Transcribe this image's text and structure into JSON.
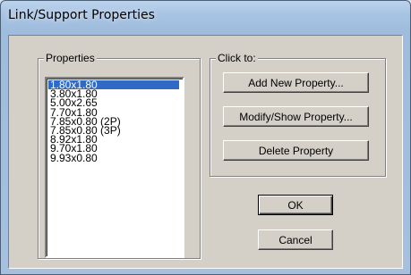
{
  "window": {
    "title": "Link/Support Properties"
  },
  "properties_group": {
    "label": "Properties",
    "items": [
      {
        "label": "1.80x1.80",
        "selected": true
      },
      {
        "label": "3.80x1.80",
        "selected": false
      },
      {
        "label": "5.00x2.65",
        "selected": false
      },
      {
        "label": "7.70x1.80",
        "selected": false
      },
      {
        "label": "7.85x0.80 (2P)",
        "selected": false
      },
      {
        "label": "7.85x0.80 (3P)",
        "selected": false
      },
      {
        "label": "8.92x1.80",
        "selected": false
      },
      {
        "label": "9.70x1.80",
        "selected": false
      },
      {
        "label": "9.93x0.80",
        "selected": false
      }
    ]
  },
  "click_group": {
    "label": "Click to:",
    "add_label": "Add New Property...",
    "modify_label": "Modify/Show Property...",
    "delete_label": "Delete Property"
  },
  "actions": {
    "ok_label": "OK",
    "cancel_label": "Cancel"
  },
  "colors": {
    "selection": "#316ac5",
    "dialog_face": "#d4d0c8",
    "frame": "#a9c4e3"
  }
}
